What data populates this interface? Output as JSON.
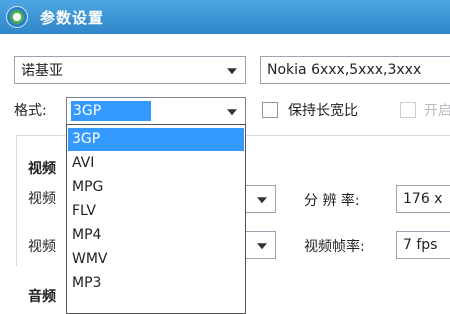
{
  "window": {
    "title": "参数设置"
  },
  "device": {
    "brand_value": "诺基亚",
    "model_value": "Nokia 6xxx,5xxx,3xxx"
  },
  "format": {
    "label": "格式:",
    "selected": "3GP",
    "keep_ratio_label": "保持长宽比",
    "enable_label": "开启"
  },
  "video": {
    "section_label": "视频",
    "encoder_label": "视频",
    "bitrate_label": "视频",
    "resolution_label": "分 辨 率:",
    "resolution_value": "176 x",
    "framerate_label": "视频帧率:",
    "framerate_value": "7 fps"
  },
  "audio": {
    "section_label": "音频"
  },
  "dropdown": {
    "options": [
      "3GP",
      "AVI",
      "MPG",
      "FLV",
      "MP4",
      "WMV",
      "MP3"
    ],
    "selected_index": 0
  }
}
